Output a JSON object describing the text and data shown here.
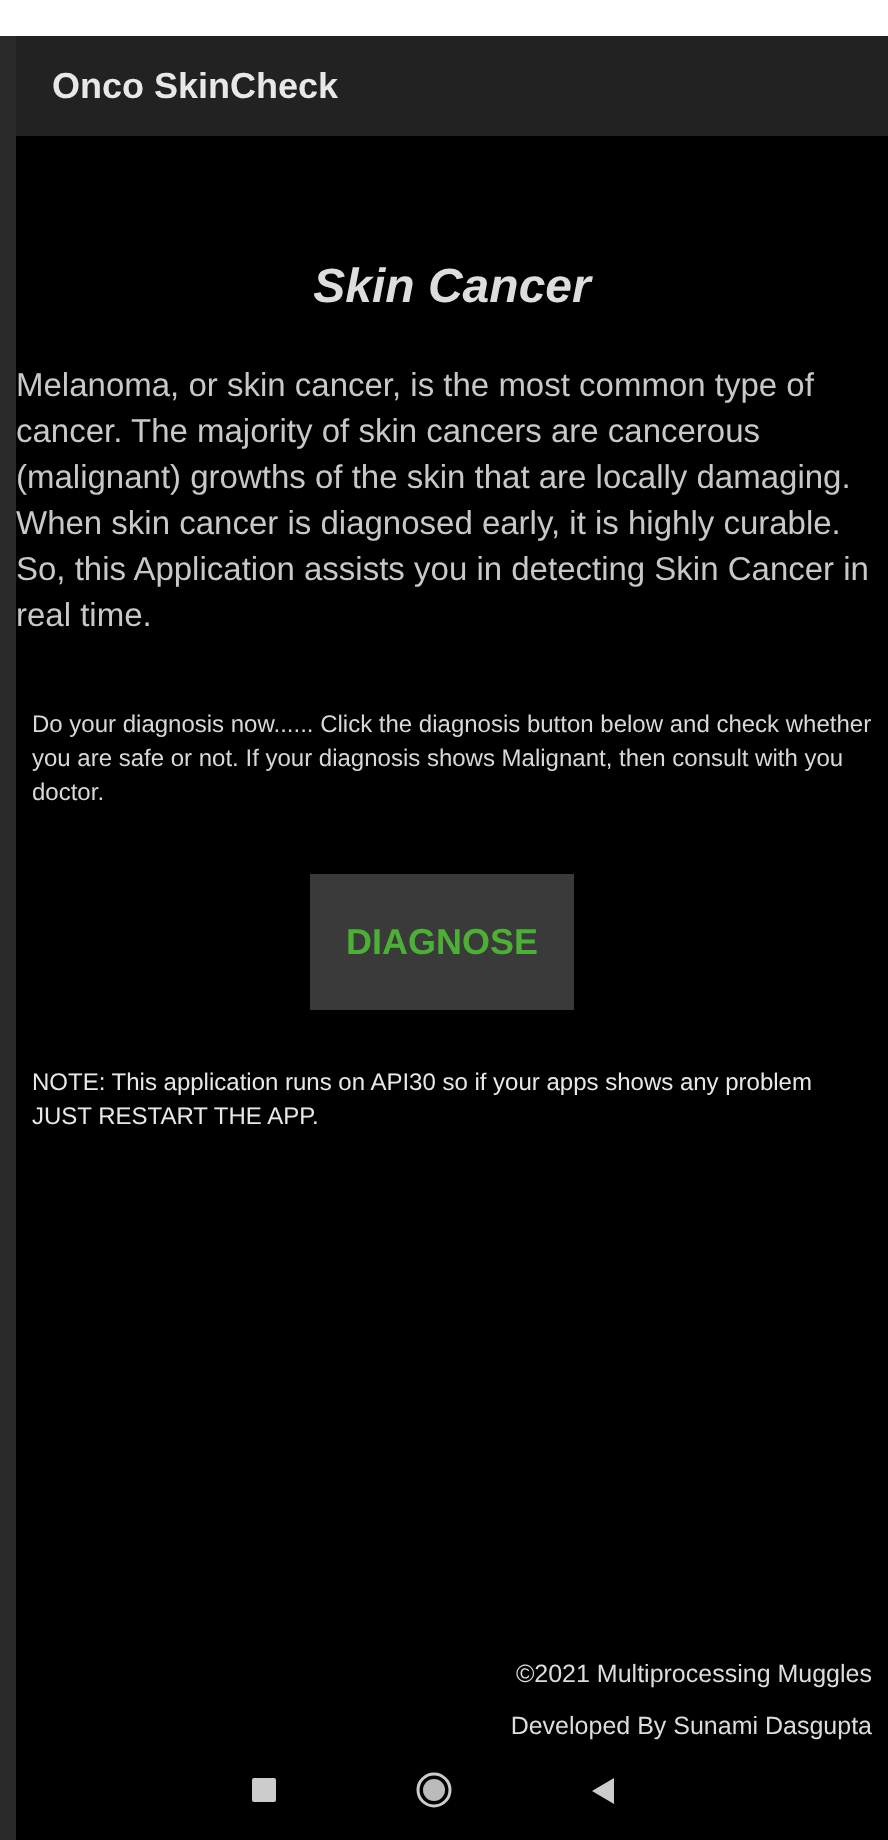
{
  "app_bar": {
    "title": "Onco SkinCheck"
  },
  "heading": "Skin Cancer",
  "intro": "Melanoma, or skin cancer, is the most common type of cancer. The majority of skin cancers are cancerous (malignant) growths of the skin that are locally damaging. When skin cancer is diagnosed early, it is highly curable. So, this Application assists you in detecting Skin Cancer in real time.",
  "instructions": "Do your diagnosis now...... Click the diagnosis button below and check whether you are safe or not. If your diagnosis shows Malignant, then consult with you doctor.",
  "diagnose_button": "DIAGNOSE",
  "note": "NOTE: This application runs on API30 so if your apps shows any problem JUST RESTART THE APP.",
  "footer": [
    "©2021 Multiprocessing Muggles",
    "Developed By Sunami Dasgupta"
  ]
}
